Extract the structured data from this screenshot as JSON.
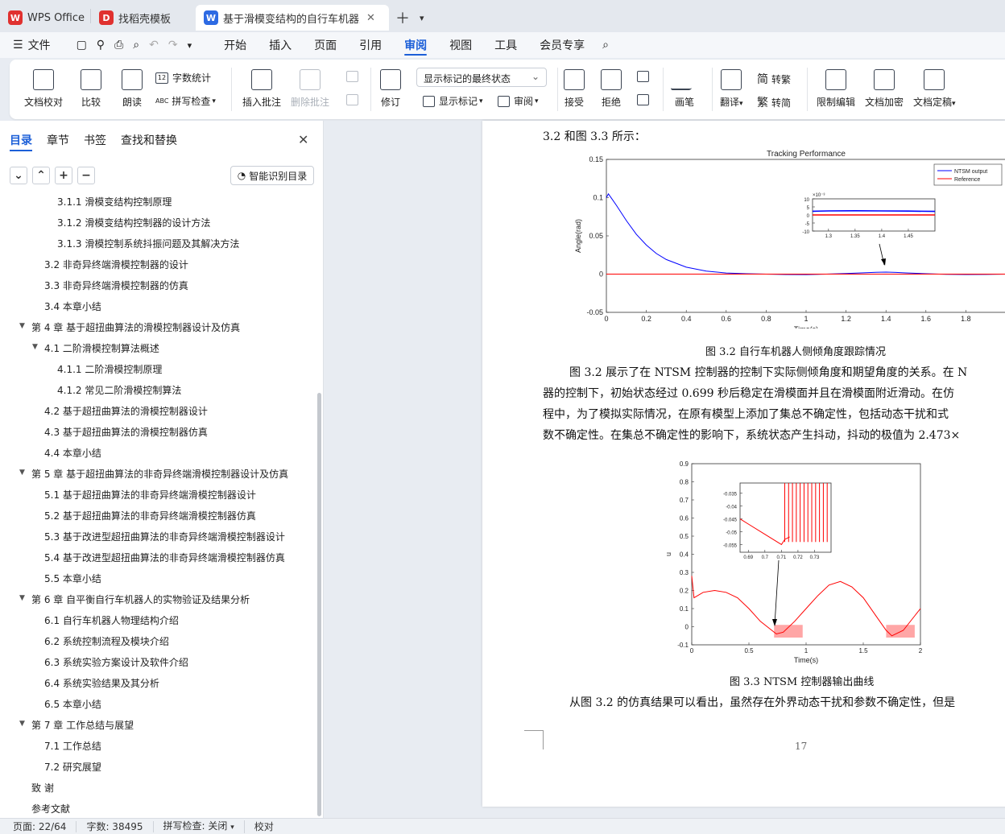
{
  "tabs": [
    {
      "label": "WPS Office",
      "logo": "W"
    },
    {
      "label": "找稻壳模板",
      "logo": "D"
    },
    {
      "label": "基于滑模变结构的自行车机器人",
      "logo": "W"
    }
  ],
  "menu": {
    "file": "文件",
    "items": [
      "开始",
      "插入",
      "页面",
      "引用",
      "审阅",
      "视图",
      "工具",
      "会员专享"
    ],
    "active": "审阅"
  },
  "ribbon": {
    "doc_check": "文档校对",
    "compare": "比较",
    "read_aloud": "朗读",
    "word_count": "字数统计",
    "spell_check": "拼写检查",
    "insert_comment": "插入批注",
    "delete_comment": "删除批注",
    "revise": "修订",
    "markup_dropdown": "显示标记的最终状态",
    "show_markup": "显示标记",
    "review": "审阅",
    "accept": "接受",
    "reject": "拒绝",
    "pen": "画笔",
    "translate": "翻译",
    "trad": "转繁",
    "simp": "转简",
    "restrict_edit": "限制编辑",
    "encrypt": "文档加密",
    "finalize": "文档定稿",
    "wc_icon_text": "12",
    "spell_icon_text": "ABC",
    "trad_char": "简",
    "simp_char": "繁"
  },
  "sidebar": {
    "tabs": [
      "目录",
      "章节",
      "书签",
      "查找和替换"
    ],
    "smart_button": "智能识别目录",
    "toc": [
      {
        "t": "3.1.1 滑模变结构控制原理",
        "lv": 3
      },
      {
        "t": "3.1.2  滑模变结构控制器的设计方法",
        "lv": 3
      },
      {
        "t": "3.1.3 滑模控制系统抖振问题及其解决方法",
        "lv": 3
      },
      {
        "t": "3.2  非奇异终端滑模控制器的设计",
        "lv": 2
      },
      {
        "t": "3.3  非奇异终端滑模控制器的仿真",
        "lv": 2
      },
      {
        "t": "3.4  本章小结",
        "lv": 2
      },
      {
        "t": "第 4 章  基于超扭曲算法的滑模控制器设计及仿真",
        "lv": 1,
        "exp": true
      },
      {
        "t": "4.1  二阶滑模控制算法概述",
        "lv": 2,
        "exp": true
      },
      {
        "t": "4.1.1  二阶滑模控制原理",
        "lv": 3
      },
      {
        "t": "4.1.2  常见二阶滑模控制算法",
        "lv": 3
      },
      {
        "t": "4.2  基于超扭曲算法的滑模控制器设计",
        "lv": 2
      },
      {
        "t": "4.3  基于超扭曲算法的滑模控制器仿真",
        "lv": 2
      },
      {
        "t": "4.4  本章小结",
        "lv": 2
      },
      {
        "t": "第 5 章  基于超扭曲算法的非奇异终端滑模控制器设计及仿真",
        "lv": 1,
        "exp": true
      },
      {
        "t": "5.1  基于超扭曲算法的非奇异终端滑模控制器设计",
        "lv": 2
      },
      {
        "t": "5.2  基于超扭曲算法的非奇异终端滑模控制器仿真",
        "lv": 2
      },
      {
        "t": "5.3  基于改进型超扭曲算法的非奇异终端滑模控制器设计",
        "lv": 2
      },
      {
        "t": "5.4  基于改进型超扭曲算法的非奇异终端滑模控制器仿真",
        "lv": 2
      },
      {
        "t": "5.5  本章小结",
        "lv": 2
      },
      {
        "t": "第 6 章  自平衡自行车机器人的实物验证及结果分析",
        "lv": 1,
        "exp": true
      },
      {
        "t": "6.1  自行车机器人物理结构介绍",
        "lv": 2
      },
      {
        "t": "6.2  系统控制流程及模块介绍",
        "lv": 2
      },
      {
        "t": "6.3  系统实验方案设计及软件介绍",
        "lv": 2
      },
      {
        "t": "6.4  系统实验结果及其分析",
        "lv": 2
      },
      {
        "t": "6.5  本章小结",
        "lv": 2
      },
      {
        "t": "第 7 章  工作总结与展望",
        "lv": 1,
        "exp": true
      },
      {
        "t": "7.1  工作总结",
        "lv": 2
      },
      {
        "t": "7.2  研究展望",
        "lv": 2
      },
      {
        "t": "致    谢",
        "lv": 1
      },
      {
        "t": "参考文献",
        "lv": 1
      }
    ]
  },
  "document": {
    "line_top": "3.2 和图 3.3 所示：",
    "caption1": "图 3.2  自行车机器人侧倾角度跟踪情况",
    "para1": [
      "图 3.2 展示了在 NTSM 控制器的控制下实际侧倾角度和期望角度的关系。在 N",
      "器的控制下，初始状态经过 0.699 秒后稳定在滑模面并且在滑模面附近滑动。在仿",
      "程中，为了模拟实际情况，在原有模型上添加了集总不确定性，包括动态干扰和式",
      "数不确定性。在集总不确定性的影响下，系统状态产生抖动，抖动的极值为 2.473×"
    ],
    "caption2": "图 3.3 NTSM 控制器输出曲线",
    "para2": "从图 3.2 的仿真结果可以看出，虽然存在外界动态干扰和参数不确定性，但是",
    "page_number": "17"
  },
  "chart_data": [
    {
      "type": "line",
      "title": "Tracking Performance",
      "xlabel": "Time(s)",
      "ylabel": "Angle(rad)",
      "xlim": [
        0,
        2
      ],
      "ylim": [
        -0.05,
        0.15
      ],
      "xticks": [
        "0",
        "0.2",
        "0.4",
        "0.6",
        "0.8",
        "1",
        "1.2",
        "1.4",
        "1.6",
        "1.8"
      ],
      "yticks": [
        "0.15",
        "0.1",
        "0.05",
        "0",
        "-0.05"
      ],
      "legend": "top-right",
      "series": [
        {
          "name": "NTSM output",
          "color": "#0000ff",
          "x": [
            0,
            0.01,
            0.05,
            0.1,
            0.15,
            0.2,
            0.25,
            0.3,
            0.4,
            0.5,
            0.6,
            0.7,
            0.8,
            0.9,
            1.0,
            1.1,
            1.2,
            1.3,
            1.35,
            1.4,
            1.45,
            1.5,
            1.6,
            1.7,
            1.8,
            1.9,
            2.0
          ],
          "y": [
            0.1,
            0.105,
            0.09,
            0.07,
            0.052,
            0.038,
            0.027,
            0.019,
            0.009,
            0.004,
            0.0015,
            0.0005,
            0.0,
            -0.0005,
            -0.0006,
            0.0,
            0.0008,
            0.0018,
            0.0024,
            0.0026,
            0.0022,
            0.0016,
            0.0005,
            -0.0003,
            -0.0005,
            -0.0004,
            0.0
          ]
        },
        {
          "name": "Reference",
          "color": "#ff0000",
          "x": [
            0,
            2
          ],
          "y": [
            0,
            0
          ]
        }
      ],
      "inset": {
        "xlim": [
          1.27,
          1.5
        ],
        "ylim": [
          -10,
          10
        ],
        "scale_label": "×10⁻³",
        "xticks": [
          "1.3",
          "1.35",
          "1.4",
          "1.45"
        ],
        "yticks": [
          "10",
          "5",
          "0",
          "-5",
          "-10"
        ],
        "series": [
          {
            "name": "NTSM output",
            "color": "#0000ff",
            "x": [
              1.27,
              1.3,
              1.35,
              1.4,
              1.45,
              1.5
            ],
            "y": [
              2.3,
              2.5,
              2.6,
              2.5,
              2.4,
              2.2
            ]
          },
          {
            "name": "Reference",
            "color": "#ff0000",
            "x": [
              1.27,
              1.5
            ],
            "y": [
              0,
              0
            ]
          }
        ]
      }
    },
    {
      "type": "line",
      "xlabel": "Time(s)",
      "ylabel": "u",
      "xlim": [
        0,
        2
      ],
      "ylim": [
        -0.1,
        0.9
      ],
      "xticks": [
        "0",
        "0.5",
        "1",
        "1.5",
        "2"
      ],
      "yticks": [
        "0.9",
        "0.8",
        "0.7",
        "0.6",
        "0.5",
        "0.4",
        "0.3",
        "0.2",
        "0.1",
        "0",
        "-0.1"
      ],
      "series": [
        {
          "color": "#ff0000",
          "x": [
            0,
            0.02,
            0.1,
            0.2,
            0.3,
            0.4,
            0.5,
            0.6,
            0.7,
            0.74,
            0.8,
            0.9,
            1.0,
            1.1,
            1.2,
            1.3,
            1.4,
            1.5,
            1.6,
            1.7,
            1.75,
            1.85,
            1.95,
            2.0
          ],
          "y": [
            0.28,
            0.16,
            0.19,
            0.2,
            0.19,
            0.16,
            0.1,
            0.03,
            -0.02,
            -0.04,
            -0.03,
            0.03,
            0.1,
            0.17,
            0.23,
            0.25,
            0.22,
            0.16,
            0.07,
            -0.02,
            -0.05,
            -0.02,
            0.06,
            0.1
          ]
        }
      ],
      "inset": {
        "xlim": [
          0.685,
          0.74
        ],
        "ylim": [
          -0.058,
          -0.031
        ],
        "xticks": [
          "0.69",
          "0.7",
          "0.71",
          "0.72",
          "0.73"
        ],
        "yticks": [
          "-0.035",
          "-0.04",
          "-0.045",
          "-0.05",
          "-0.055"
        ],
        "series": [
          {
            "color": "#ff0000",
            "x": [
              0.685,
              0.69,
              0.7,
              0.71,
              0.712,
              0.715
            ],
            "y": [
              -0.045,
              -0.047,
              -0.051,
              -0.055,
              -0.053,
              -0.052
            ]
          }
        ]
      }
    }
  ],
  "status": {
    "page": "页面: 22/64",
    "words": "字数: 38495",
    "spell": "拼写检查: 关闭",
    "proof": "校对"
  }
}
